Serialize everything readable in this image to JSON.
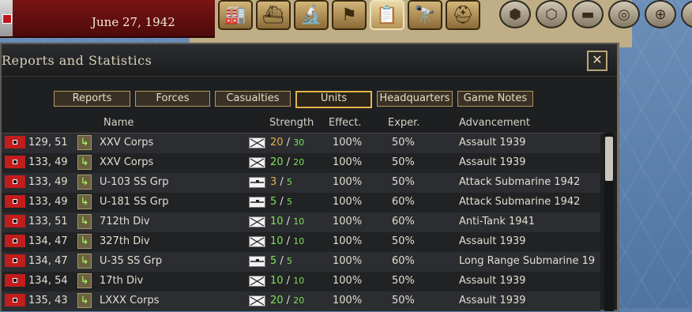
{
  "top": {
    "date": "June 27, 1942"
  },
  "toolbar": {
    "buttons": [
      "factory-icon",
      "ship-icon",
      "microscope-icon",
      "flag-icon",
      "clipboard-icon",
      "binoculars-icon",
      "helmet-icon"
    ],
    "hex_buttons": [
      "hex-icon",
      "hex-cluster-icon",
      "tank-icon",
      "coins-icon",
      "target-icon",
      "gear-icon"
    ]
  },
  "window": {
    "title": "Reports and Statistics",
    "close": "✕"
  },
  "tabs": [
    {
      "label": "Reports"
    },
    {
      "label": "Forces"
    },
    {
      "label": "Casualties"
    },
    {
      "label": "Units"
    },
    {
      "label": "Headquarters"
    },
    {
      "label": "Game Notes"
    }
  ],
  "active_tab": "Units",
  "columns": {
    "name": "Name",
    "strength": "Strength",
    "effect": "Effect.",
    "exper": "Exper.",
    "advancement": "Advancement"
  },
  "rows": [
    {
      "loc": "129, 51",
      "name": "XXV Corps",
      "type": "infantry",
      "cur": "20",
      "sep": " / ",
      "max": "30",
      "full": false,
      "eff": "100%",
      "exp": "50%",
      "adv": "Assault  1939"
    },
    {
      "loc": "133, 49",
      "name": "XXV Corps",
      "type": "infantry",
      "cur": "20",
      "sep": " / ",
      "max": "20",
      "full": true,
      "eff": "100%",
      "exp": "50%",
      "adv": "Assault  1939"
    },
    {
      "loc": "133, 49",
      "name": "U-103 SS Grp",
      "type": "submarine",
      "cur": "3",
      "sep": " / ",
      "max": "5",
      "full": false,
      "eff": "100%",
      "exp": "50%",
      "adv": "Attack Submarine  1942"
    },
    {
      "loc": "133, 49",
      "name": "U-181 SS Grp",
      "type": "submarine",
      "cur": "5",
      "sep": " / ",
      "max": "5",
      "full": true,
      "eff": "100%",
      "exp": "60%",
      "adv": "Attack Submarine  1942"
    },
    {
      "loc": "133, 51",
      "name": "712th Div",
      "type": "infantry",
      "cur": "10",
      "sep": " / ",
      "max": "10",
      "full": true,
      "eff": "100%",
      "exp": "60%",
      "adv": "Anti-Tank  1941"
    },
    {
      "loc": "134, 47",
      "name": "327th Div",
      "type": "infantry",
      "cur": "10",
      "sep": " / ",
      "max": "10",
      "full": true,
      "eff": "100%",
      "exp": "50%",
      "adv": "Assault  1939"
    },
    {
      "loc": "134, 47",
      "name": "U-35 SS Grp",
      "type": "submarine",
      "cur": "5",
      "sep": " / ",
      "max": "5",
      "full": true,
      "eff": "100%",
      "exp": "60%",
      "adv": "Long Range Submarine  19"
    },
    {
      "loc": "134, 54",
      "name": "17th Div",
      "type": "infantry",
      "cur": "10",
      "sep": " / ",
      "max": "10",
      "full": true,
      "eff": "100%",
      "exp": "50%",
      "adv": "Assault  1939"
    },
    {
      "loc": "135, 43",
      "name": "LXXX Corps",
      "type": "infantry",
      "cur": "20",
      "sep": " / ",
      "max": "20",
      "full": true,
      "eff": "100%",
      "exp": "50%",
      "adv": "Assault  1939"
    }
  ],
  "colors": {
    "strength_partial": "#e6b24a",
    "strength_full": "#7fe05c",
    "active_tab_border": "#e2b546"
  }
}
